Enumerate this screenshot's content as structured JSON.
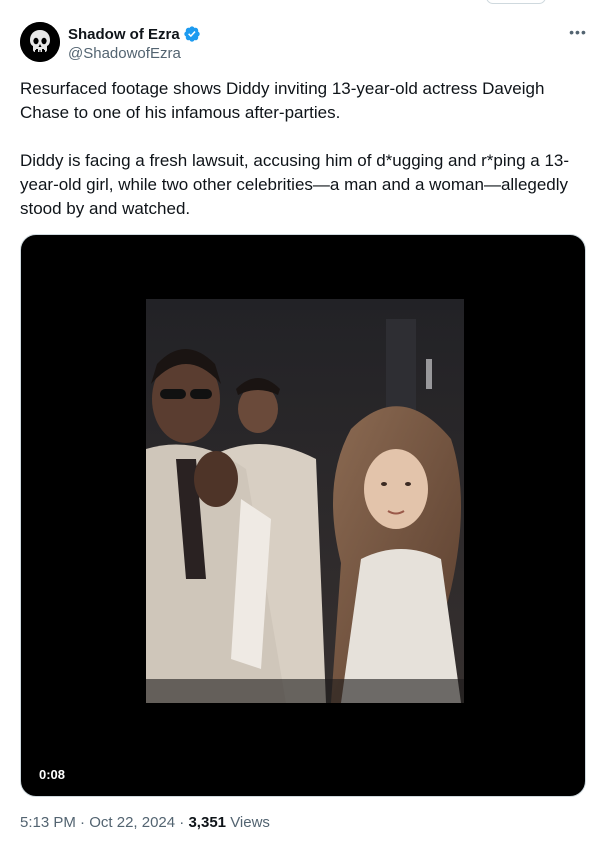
{
  "author": {
    "display_name": "Shadow of Ezra",
    "handle": "@ShadowofEzra",
    "verified": true
  },
  "more_icon": "more-horizontal-icon",
  "tweet": {
    "paragraphs": [
      "Resurfaced footage shows Diddy inviting 13-year-old actress Daveigh Chase to one of his infamous after-parties.",
      "Diddy is facing a fresh lawsuit, accusing him of d*ugging and r*ping a 13-year-old girl, while two other celebrities—a man and a woman—allegedly stood by and watched."
    ]
  },
  "video": {
    "timestamp": "0:08"
  },
  "meta": {
    "time": "5:13 PM",
    "date": "Oct 22, 2024",
    "separator": "·",
    "views_count": "3,351",
    "views_label": "Views"
  },
  "colors": {
    "verified_blue": "#1d9bf0",
    "text_primary": "#0f1419",
    "text_secondary": "#536471"
  }
}
